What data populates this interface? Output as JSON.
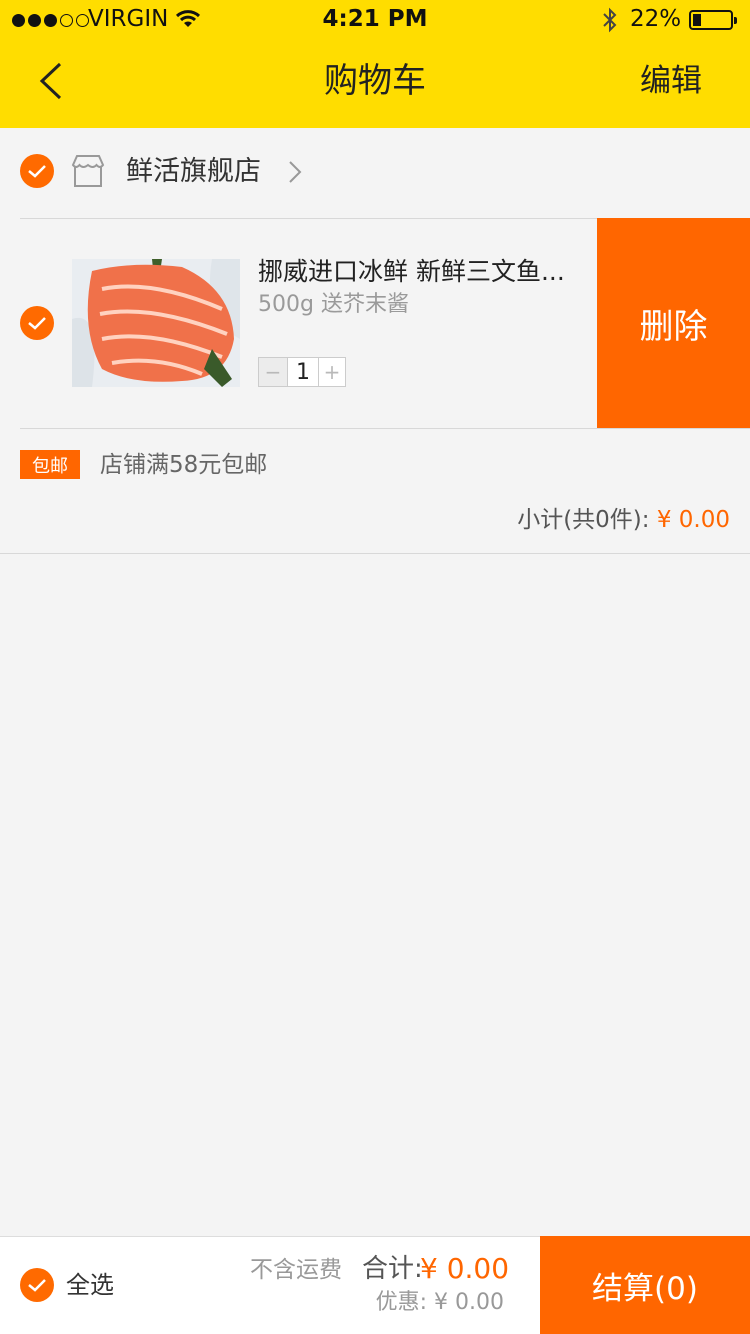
{
  "status": {
    "carrier": "VIRGIN",
    "time": "4:21 PM",
    "battery": "22%",
    "battery_level": 0.22
  },
  "header": {
    "title": "购物车",
    "edit_label": "编辑"
  },
  "shop": {
    "name": "鲜活旗舰店",
    "item": {
      "title": "挪威进口冰鲜 新鲜三文鱼...",
      "spec": "500g 送芥末酱",
      "qty": "1",
      "minus": "−",
      "plus": "+",
      "delete_label": "删除"
    },
    "shipping_badge": "包邮",
    "shipping_text": "店铺满58元包邮",
    "subtotal_label": "小计(共0件): ",
    "subtotal_value": "¥ 0.00"
  },
  "footer": {
    "select_all": "全选",
    "freight_note": "不含运费",
    "total_label": "合计:",
    "total_value": "¥ 0.00",
    "discount": "优惠: ¥ 0.00",
    "checkout": "结算(0)"
  },
  "colors": {
    "header_bg": "#ffdd00",
    "accent": "#ff6600",
    "bg": "#f4f4f4"
  }
}
